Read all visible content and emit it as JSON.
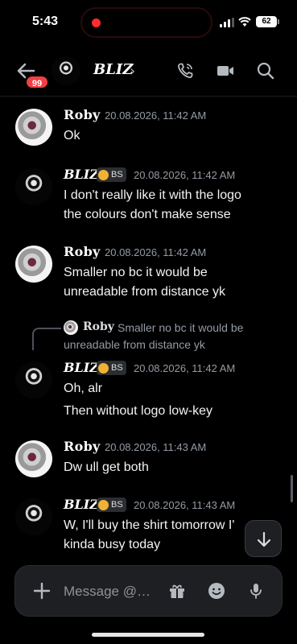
{
  "status_bar": {
    "time": "5:43",
    "battery": "62"
  },
  "header": {
    "title": "BLIZ",
    "chevron": "›",
    "unread_count": "99"
  },
  "messages": [
    {
      "author": "Roby",
      "timestamp": "20.08.2026, 11:42 AM",
      "lines": [
        "Ok"
      ]
    },
    {
      "author": "BLIZ",
      "tag": "BS",
      "timestamp": "20.08.2026, 11:42 AM",
      "lines": [
        "I don't really like it with the logo",
        "the colours don't make sense"
      ]
    },
    {
      "author": "Roby",
      "timestamp": "20.08.2026, 11:42 AM",
      "lines": [
        "Smaller no bc it would be",
        "unreadable from distance yk"
      ]
    },
    {
      "reply_to": {
        "author": "Roby",
        "text": "Smaller no bc it would be unreadable from distance yk"
      },
      "author": "BLIZ",
      "tag": "BS",
      "timestamp": "20.08.2026, 11:42 AM",
      "lines": [
        "Oh, alr",
        "Then without logo low-key"
      ]
    },
    {
      "author": "Roby",
      "timestamp": "20.08.2026, 11:43 AM",
      "lines": [
        "Dw ull get both"
      ]
    },
    {
      "author": "BLIZ",
      "tag": "BS",
      "timestamp": "20.08.2026, 11:43 AM",
      "lines": [
        "W, I'll buy the shirt tomorrow I'",
        "kinda busy today"
      ]
    }
  ],
  "composer": {
    "placeholder": "Message @…"
  },
  "icons": {
    "back": "arrow-left-icon",
    "call": "phone-icon",
    "video": "video-camera-icon",
    "search": "search-icon",
    "plus": "plus-icon",
    "gift": "gift-icon",
    "emoji": "emoji-icon",
    "mic": "microphone-icon",
    "jump": "arrow-down-icon"
  },
  "colors": {
    "background": "#000000",
    "badge": "#f23f43",
    "muted": "#949ba4"
  }
}
